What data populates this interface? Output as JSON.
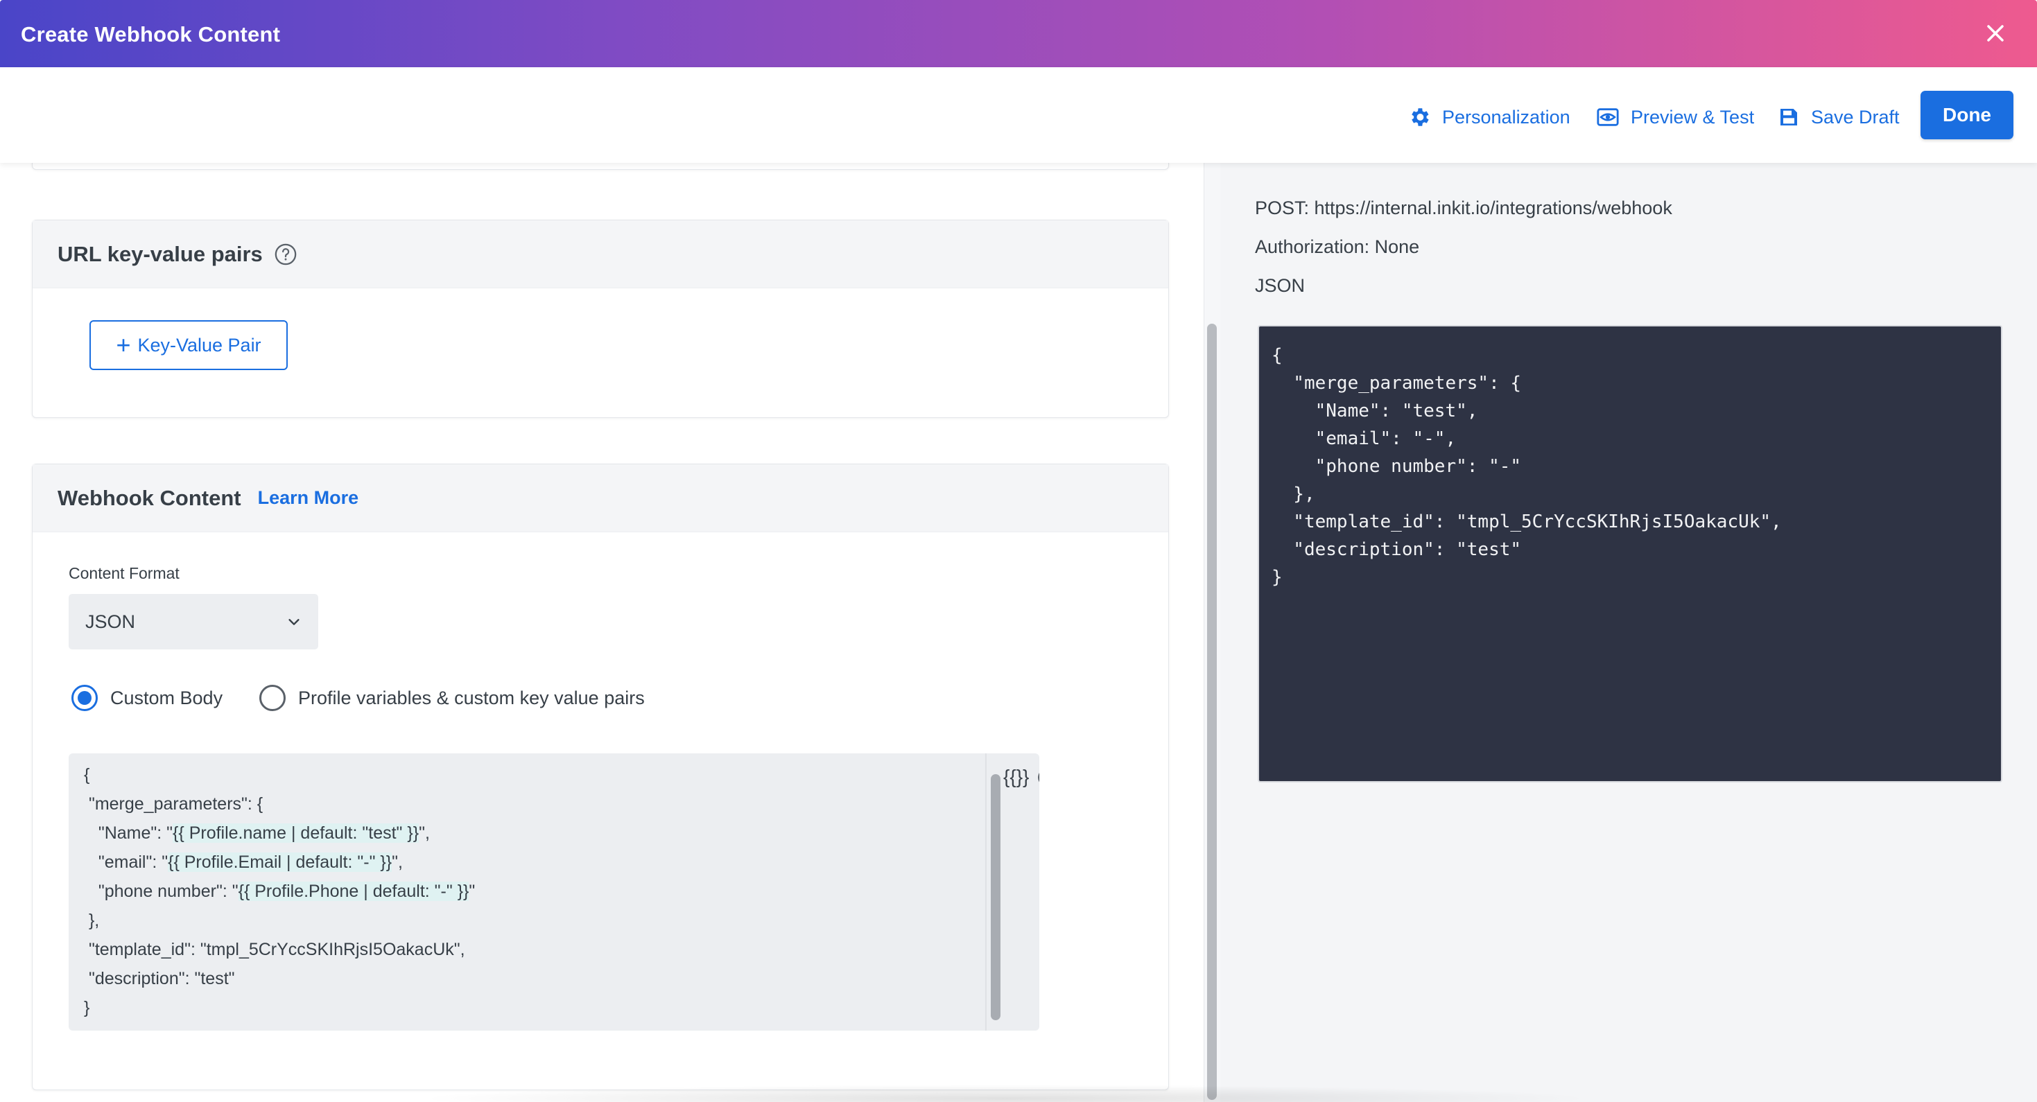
{
  "window": {
    "title": "Create Webhook Content"
  },
  "toolbar": {
    "personalization_label": "Personalization",
    "preview_label": "Preview & Test",
    "save_draft_label": "Save Draft",
    "done_label": "Done"
  },
  "url_pairs": {
    "title": "URL key-value pairs",
    "add_button_label": "Key-Value Pair"
  },
  "webhook_content": {
    "title": "Webhook Content",
    "learn_more_label": "Learn More",
    "content_format_label": "Content Format",
    "content_format_value": "JSON",
    "radio_custom_body": "Custom Body",
    "radio_profile_vars": "Profile variables & custom key value pairs",
    "selected_option": "Custom Body",
    "editor_lines": {
      "l1": "{",
      "l2": " \"merge_parameters\": {",
      "l3a": "   \"Name\": \"",
      "l3b": "{{ Profile.name | default: \"test\" }}",
      "l3c": "\",",
      "l4a": "   \"email\": \"",
      "l4b": "{{ Profile.Email | default: \"-\" }}",
      "l4c": "\",",
      "l5a": "   \"phone number\": \"",
      "l5b": "{{ Profile.Phone | default: \"-\" }}",
      "l5c": "\"",
      "l6": " },",
      "l7": " \"template_id\": \"tmpl_5CrYccSKIhRjsI5OakacUk\",",
      "l8": " \"description\": \"test\"",
      "l9": "}"
    },
    "editor_tool_braces": "{{}}",
    "editor_tool_at": "@"
  },
  "preview": {
    "post_line": "POST: https://internal.inkit.io/integrations/webhook",
    "auth_line": "Authorization: None",
    "format_line": "JSON",
    "code": "{\n  \"merge_parameters\": {\n    \"Name\": \"test\",\n    \"email\": \"-\",\n    \"phone number\": \"-\"\n  },\n  \"template_id\": \"tmpl_5CrYccSKIhRjsI5OakacUk\",\n  \"description\": \"test\"\n}"
  },
  "colors": {
    "accent": "#1a6ee0",
    "header_gradient_start": "#4a45c8",
    "header_gradient_end": "#ee5a8f",
    "code_bg": "#2e3344"
  }
}
